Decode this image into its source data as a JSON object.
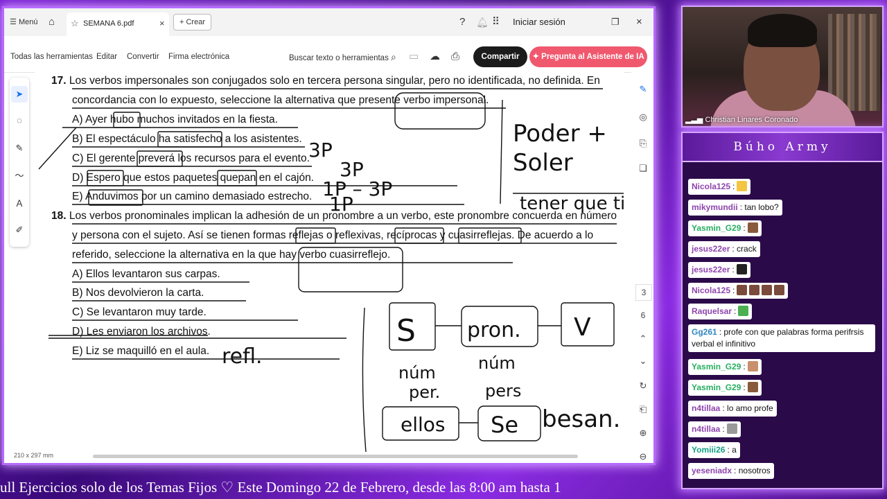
{
  "browser": {
    "menu_label": "Menú",
    "tab_title": "SEMANA 6.pdf",
    "new_button": "Crear",
    "signin": "Iniciar sesión"
  },
  "toolbar": {
    "all_tools": "Todas las herramientas",
    "edit": "Editar",
    "convert": "Convertir",
    "esign": "Firma electrónica",
    "search": "Buscar texto o herramientas",
    "share": "Compartir",
    "ai_assistant": "Pregunta al Asistente de IA"
  },
  "pdf": {
    "q17": {
      "num": "17.",
      "line1": "Los verbos impersonales son conjugados solo en tercera persona singular, pero no identificada, no definida. En",
      "line2": "concordancia con lo expuesto, seleccione la alternativa que presente verbo impersonal.",
      "a": "A) Ayer hubo muchos invitados en la fiesta.",
      "b": "B) El espectáculo ha satisfecho a los asistentes.",
      "c": "C) El gerente preverá los recursos para el evento.",
      "d": "D) Espero que estos paquetes quepan en el cajón.",
      "e": "E) Anduvimos por un camino demasiado estrecho."
    },
    "q18": {
      "num": "18.",
      "line1": "Los verbos pronominales implican la adhesión de un pronombre a un verbo, este pronombre concuerda en número",
      "line2": "y persona con el sujeto. Así se tienen formas reflejas o reflexivas, recíprocas y cuasirreflejas. De acuerdo a lo",
      "line3": "referido, seleccione la alternativa en la que hay verbo cuasirreflejo.",
      "a": "A) Ellos levantaron sus carpas.",
      "b": "B) Nos devolvieron la carta.",
      "c": "C) Se levantaron muy tarde.",
      "d": "D) Les enviaron los archivos.",
      "e": "E) Liz se maquilló en el aula."
    },
    "handwriting": {
      "n1": "Poder +",
      "n2": "Soler",
      "n3": "tener que ting",
      "b_note": "3P",
      "c_note": "3P",
      "d_note": "1P – 3P",
      "e_note": "1P",
      "refl": "refl.",
      "s": "S",
      "pron": "pron.",
      "v": "V",
      "num1": "núm",
      "per": "per.",
      "num2": "núm",
      "pers": "pers",
      "ellos": "ellos",
      "se": "Se",
      "besan": "besan."
    },
    "page_size": "210 x 297 mm",
    "page_numbers": [
      "3",
      "6"
    ]
  },
  "camera": {
    "name": "Christian Linares Coronado"
  },
  "chat": {
    "title": "Búho Army",
    "messages": [
      {
        "user": "Nicola125",
        "text": ":",
        "color": "#8e44ad",
        "emotes": [
          "#f4c542"
        ]
      },
      {
        "user": "mikymundii",
        "text": ": tan lobo?",
        "color": "#8e44ad",
        "emotes": []
      },
      {
        "user": "Yasmin_G29",
        "text": ":",
        "color": "#27ae60",
        "emotes": [
          "#8a5a3c"
        ]
      },
      {
        "user": "jesus22er",
        "text": ": crack",
        "color": "#8e44ad",
        "emotes": []
      },
      {
        "user": "jesus22er",
        "text": ":",
        "color": "#8e44ad",
        "emotes": [
          "#222"
        ]
      },
      {
        "user": "Nicola125",
        "text": ":",
        "color": "#8e44ad",
        "emotes": [
          "#7a4a3a",
          "#7a4a3a",
          "#7a4a3a",
          "#7a4a3a"
        ]
      },
      {
        "user": "Raquelsar",
        "text": ":",
        "color": "#8e44ad",
        "emotes": [
          "#4caf50"
        ]
      },
      {
        "user": "Gg261",
        "text": ": profe con que palabras forma perifrsis verbal el infinitivo",
        "color": "#2e86c1",
        "emotes": []
      },
      {
        "user": "Yasmin_G29",
        "text": ":",
        "color": "#27ae60",
        "emotes": [
          "#c8906c"
        ]
      },
      {
        "user": "Yasmin_G29",
        "text": ":",
        "color": "#27ae60",
        "emotes": [
          "#8a5a3c"
        ]
      },
      {
        "user": "n4tillaa",
        "text": ": lo amo profe",
        "color": "#8e44ad",
        "emotes": []
      },
      {
        "user": "n4tillaa",
        "text": ":",
        "color": "#8e44ad",
        "emotes": [
          "#999"
        ]
      },
      {
        "user": "Yomiii26",
        "text": ": a",
        "color": "#16a085",
        "emotes": []
      },
      {
        "user": "yeseniadx",
        "text": ": nosotros",
        "color": "#8e44ad",
        "emotes": []
      }
    ]
  },
  "ticker": "ull Ejercicios solo de los Temas Fijos ♡     Este Domingo 22 de Febrero, desde las 8:00 am hasta 1"
}
